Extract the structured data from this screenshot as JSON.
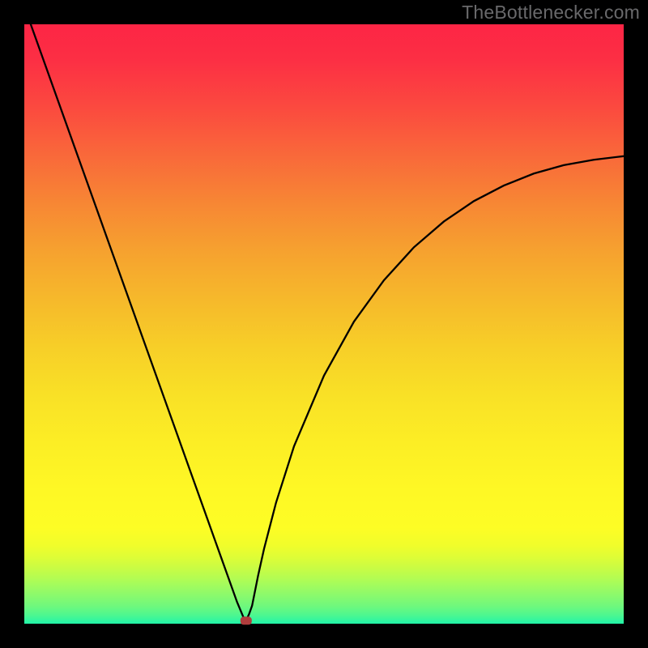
{
  "watermark": "TheBottlenecker.com",
  "chart_data": {
    "type": "line",
    "title": "",
    "xlabel": "",
    "ylabel": "",
    "xlim": [
      0,
      100
    ],
    "ylim": [
      0,
      100
    ],
    "x_minimum": 37,
    "series": [
      {
        "name": "bottleneck-curve",
        "x": [
          0,
          5,
          10,
          15,
          20,
          25,
          28,
          30,
          32,
          33,
          34,
          35,
          35.5,
          36,
          36.5,
          37,
          37.5,
          38,
          39,
          40,
          42,
          45,
          50,
          55,
          60,
          65,
          70,
          75,
          80,
          85,
          90,
          95,
          100
        ],
        "y": [
          103,
          89,
          75,
          61,
          47,
          33,
          24.6,
          19,
          13.4,
          10.6,
          7.8,
          5.0,
          3.6,
          2.4,
          1.2,
          0.5,
          1.6,
          3.0,
          8.0,
          12.5,
          20.2,
          29.6,
          41.4,
          50.4,
          57.3,
          62.8,
          67.1,
          70.5,
          73.1,
          75.1,
          76.5,
          77.4,
          78.0
        ]
      }
    ],
    "annotations": [
      {
        "name": "optimum-marker",
        "x": 37,
        "y": 0.5
      }
    ],
    "background_gradient": {
      "top": "#fd2545",
      "mid": "#f7cf28",
      "bottom": "#21f4a8"
    }
  }
}
